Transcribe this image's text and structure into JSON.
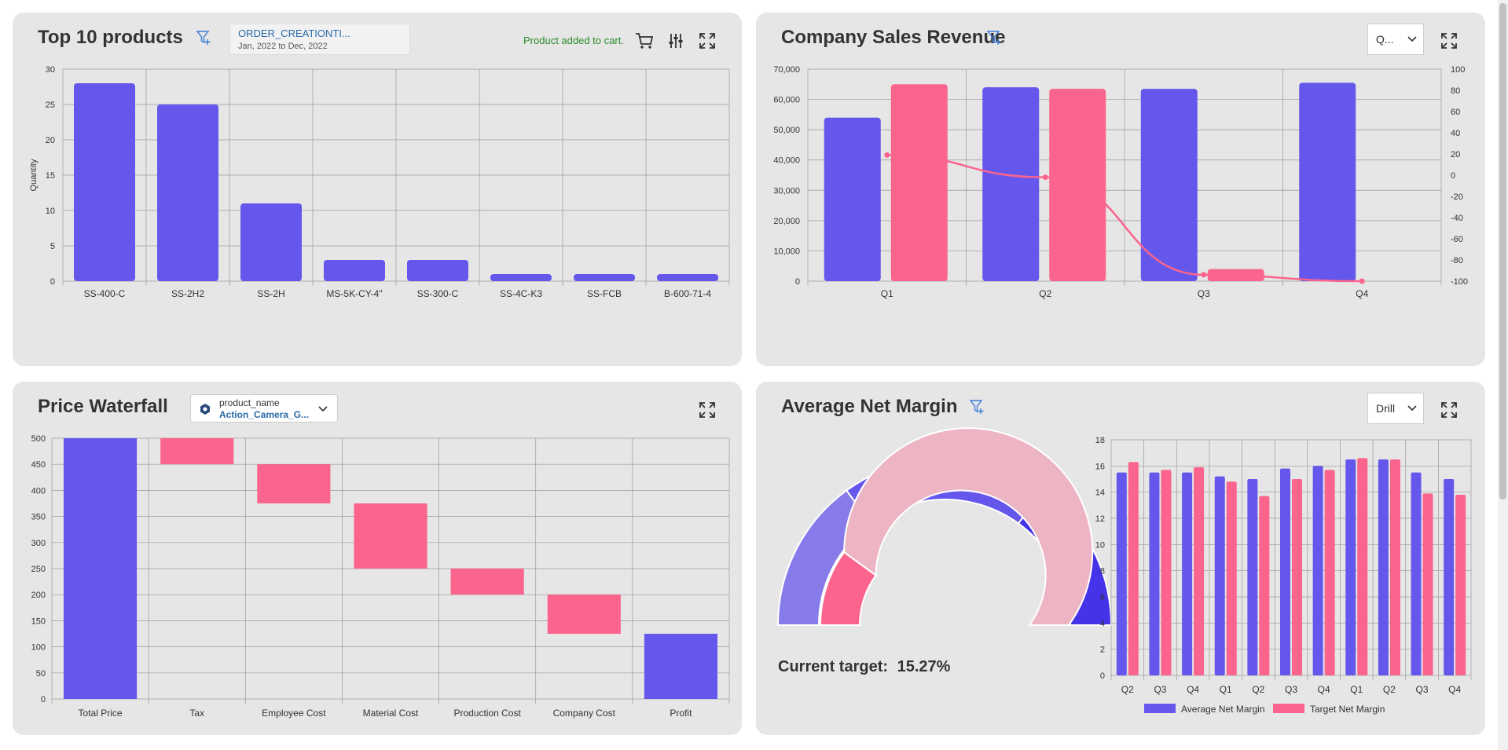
{
  "colors": {
    "blue": "#6557ec",
    "pink": "#fb648c",
    "card": "#e6e6e6",
    "grid": "#999999",
    "gauge_light_blue": "#877bea",
    "gauge_dark_blue": "#4433e8",
    "gauge_light_pink": "#edb4c4",
    "status_green": "#2a8a2a",
    "link_blue": "#2a6aa8"
  },
  "top10": {
    "title": "Top 10 products",
    "filter_field": "ORDER_CREATIONTI...",
    "filter_range": "Jan, 2022 to Dec, 2022",
    "status": "Product added to cart.",
    "icons": [
      "filter-add-icon",
      "cart-icon",
      "settings-sliders-icon",
      "expand-icon"
    ]
  },
  "revenue": {
    "title": "Company Sales Revenue",
    "select_value": "Q...",
    "icons": [
      "filter-add-icon",
      "chevron-down-icon",
      "expand-icon"
    ]
  },
  "waterfall": {
    "title": "Price Waterfall",
    "select_label": "product_name",
    "select_value": "Action_Camera_G...",
    "icons": [
      "cube-icon",
      "chevron-down-icon",
      "expand-icon"
    ]
  },
  "margin": {
    "title": "Average Net Margin",
    "select_value": "Drill",
    "current_target_label": "Current target:",
    "current_target_value": "15.27%",
    "icons": [
      "filter-add-icon",
      "chevron-down-icon",
      "expand-icon"
    ]
  },
  "chart_data": [
    {
      "id": "top10",
      "type": "bar",
      "title": "Top 10 products",
      "ylabel": "Quantity",
      "ylim": [
        0,
        30
      ],
      "yticks": [
        0,
        5,
        10,
        15,
        20,
        25,
        30
      ],
      "categories": [
        "SS-400-C",
        "SS-2H2",
        "SS-2H",
        "MS-5K-CY-4\"",
        "SS-300-C",
        "SS-4C-K3",
        "SS-FCB",
        "B-600-71-4"
      ],
      "values": [
        28,
        25,
        11,
        3,
        3,
        1,
        1,
        1
      ],
      "grid": true
    },
    {
      "id": "revenue",
      "type": "bar",
      "title": "Company Sales Revenue",
      "categories": [
        "Q1",
        "Q2",
        "Q3",
        "Q4"
      ],
      "ylim": [
        0,
        70000
      ],
      "yticks": [
        0,
        10000,
        20000,
        30000,
        40000,
        50000,
        60000,
        70000
      ],
      "ytick_labels": [
        "0",
        "10,000",
        "20,000",
        "30,000",
        "40,000",
        "50,000",
        "60,000",
        "70,000"
      ],
      "y2lim": [
        -100,
        100
      ],
      "y2ticks": [
        -100,
        -80,
        -60,
        -40,
        -20,
        0,
        20,
        40,
        60,
        80,
        100
      ],
      "series": [
        {
          "type": "bar",
          "values": [
            54000,
            64000,
            63500,
            65500
          ]
        },
        {
          "type": "bar",
          "values": [
            65000,
            63500,
            4000,
            null
          ]
        },
        {
          "type": "line",
          "axis": "right",
          "values": [
            19,
            -2,
            -94,
            -100
          ]
        }
      ],
      "grid": true
    },
    {
      "id": "waterfall",
      "type": "bar",
      "title": "Price Waterfall",
      "ylim": [
        0,
        500
      ],
      "yticks": [
        0,
        50,
        100,
        150,
        200,
        250,
        300,
        350,
        400,
        450,
        500
      ],
      "categories": [
        "Total Price",
        "Tax",
        "Employee Cost",
        "Material Cost",
        "Production Cost",
        "Company Cost",
        "Profit"
      ],
      "ranges": [
        [
          0,
          500
        ],
        [
          450,
          500
        ],
        [
          375,
          450
        ],
        [
          250,
          375
        ],
        [
          200,
          250
        ],
        [
          125,
          200
        ],
        [
          0,
          125
        ]
      ],
      "kinds": [
        "total",
        "decrease",
        "decrease",
        "decrease",
        "decrease",
        "decrease",
        "total"
      ],
      "grid": true
    },
    {
      "id": "margin_gauge",
      "type": "pie",
      "outer_ring": [
        {
          "from": 0,
          "to": 0.3
        },
        {
          "from": 0.3,
          "to": 0.7
        },
        {
          "from": 0.7,
          "to": 1.0
        }
      ],
      "inner_ring_value": 0.2,
      "label": "Current target:",
      "value_text": "15.27%"
    },
    {
      "id": "margin_bars",
      "type": "bar",
      "ylim": [
        0,
        18
      ],
      "yticks": [
        0,
        2,
        4,
        6,
        8,
        10,
        12,
        14,
        16,
        18
      ],
      "categories": [
        "Q2",
        "Q3",
        "Q4",
        "Q1",
        "Q2",
        "Q3",
        "Q4",
        "Q1",
        "Q2",
        "Q3",
        "Q4"
      ],
      "series": [
        {
          "name": "Average Net Margin",
          "values": [
            15.5,
            15.5,
            15.5,
            15.2,
            15.0,
            15.8,
            16.0,
            16.5,
            16.5,
            15.5,
            15.0
          ]
        },
        {
          "name": "Target Net Margin",
          "values": [
            16.3,
            15.7,
            15.9,
            14.8,
            13.7,
            15.0,
            15.7,
            16.6,
            16.5,
            13.9,
            13.8
          ]
        }
      ],
      "legend": "bottom",
      "grid": true
    }
  ]
}
